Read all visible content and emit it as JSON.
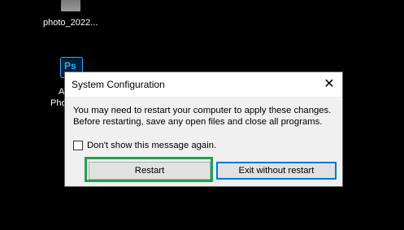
{
  "desktop": {
    "photo_label": "photo_2022...",
    "ps_icon_text": "Ps",
    "ps_label_line1": "A",
    "ps_label_line2": "Pho"
  },
  "dialog": {
    "title": "System Configuration",
    "close_glyph": "✕",
    "message": "You may need to restart your computer to apply these changes. Before restarting, save any open files and close all programs.",
    "checkbox_label": "Don't show this message again.",
    "checkbox_checked": false,
    "restart_label": "Restart",
    "exit_label": "Exit without restart"
  },
  "colors": {
    "highlight": "#1aa34a",
    "focus_border": "#0078d7"
  }
}
